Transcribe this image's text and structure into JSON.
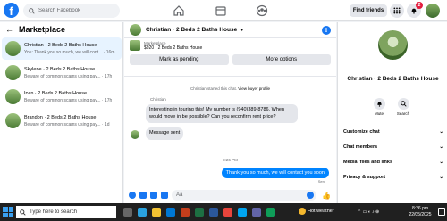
{
  "search": {
    "placeholder": "Search Facebook"
  },
  "header": {
    "find_friends": "Find friends",
    "notif_count": "2"
  },
  "sidebar": {
    "title": "Marketplace",
    "conversations": [
      {
        "name": "Christian · 2 Beds 2 Baths House",
        "preview": "You: Thank you so much, we will cont... · 16m",
        "active": true
      },
      {
        "name": "Skylene · 2 Beds 2 Baths House",
        "preview": "Beware of common scams using pay... · 17h",
        "active": false
      },
      {
        "name": "Irvin · 2 Beds 2 Baths House",
        "preview": "Beware of common scams using pay... · 17h",
        "active": false
      },
      {
        "name": "Brandon · 2 Beds 2 Baths House",
        "preview": "Beware of common scams using pay... · 1d",
        "active": false
      }
    ]
  },
  "chat": {
    "title": "Christian · 2 Beds 2 Baths House",
    "listing_label": "Marketplace",
    "listing_price": "$920 · 2 Beds 2 Baths House",
    "mark_pending": "Mark as pending",
    "more_options": "More options",
    "started_text": "Christian started this chat.",
    "view_profile": "View buyer profile",
    "sender": "Christian",
    "message_1": "Interesting in touring this! My number is (940)389-8786. When would move in be possible? Can you reconfirm rent price?",
    "message_2": "Message sent",
    "timestamp": "8:26 PM",
    "outgoing": "Thank you so much, we will contact you soon",
    "sent_label": "Sent",
    "composer_placeholder": "Aa"
  },
  "right_panel": {
    "name": "Christian · 2 Beds 2 Baths House",
    "mute": "Mute",
    "search": "Search",
    "rows": [
      "Customize chat",
      "Chat members",
      "Media, files and links",
      "Privacy & support"
    ]
  },
  "taskbar": {
    "search_placeholder": "Type here to search",
    "weather": "Hot weather",
    "time": "8:26 pm",
    "date": "22/05/2025"
  }
}
